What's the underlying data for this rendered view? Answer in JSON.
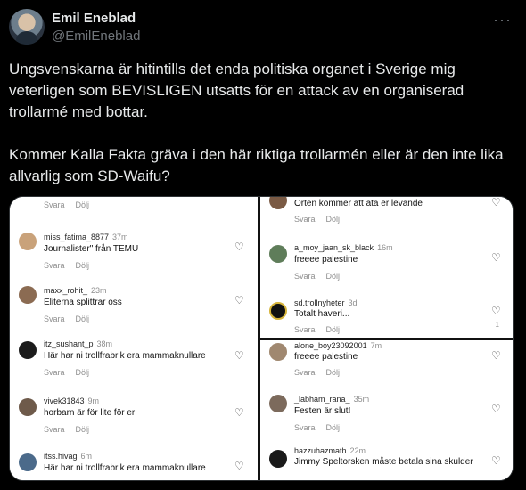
{
  "author": {
    "name": "Emil Eneblad",
    "handle": "@EmilEneblad"
  },
  "more_label": "···",
  "tweet": {
    "paragraph1": "Ungsvenskarna är hitintills det enda politiska organet i Sverige mig veterligen som BEVISLIGEN utsatts för en attack av en organiserad trollarmé med bottar.",
    "paragraph2": "Kommer Kalla Fakta gräva i den här riktiga trollarmén eller är den inte lika allvarlig som SD-Waifu?"
  },
  "actions": {
    "reply": "Svara",
    "hide": "Dölj"
  },
  "left_comments": [
    {
      "user": "",
      "time": "",
      "text": "",
      "avatar_color": "#9a7b66"
    },
    {
      "user": "miss_fatima_8877",
      "time": "37m",
      "text": "Journalister\" från TEMU",
      "avatar_color": "#c9a27a"
    },
    {
      "user": "maxx_rohit_",
      "time": "23m",
      "text": "Eliterna splittrar oss",
      "avatar_color": "#8b6b52"
    },
    {
      "user": "itz_sushant_p",
      "time": "38m",
      "text": "Här har ni trollfrabrik era mammaknullare",
      "avatar_color": "#1c1c1c"
    },
    {
      "user": "vivek31843",
      "time": "9m",
      "text": "horbarn är för lite för er",
      "avatar_color": "#6e5a4a"
    },
    {
      "user": "itss.hivag",
      "time": "6m",
      "text": "Här har ni trollfrabrik era mammaknullare",
      "avatar_color": "#4b6a8a"
    }
  ],
  "right_comments": [
    {
      "user": "",
      "time": "",
      "text": "Orten kommer att äta er levande",
      "avatar_color": "#7a5a44",
      "likes": ""
    },
    {
      "user": "a_moy_jaan_sk_black",
      "time": "16m",
      "text": "freeee palestine",
      "avatar_color": "#5f7d5a",
      "likes": ""
    },
    {
      "user": "sd.trollnyheter",
      "time": "3d",
      "text": "Totalt haveri...",
      "avatar_color": "#111111",
      "likes": "1"
    },
    {
      "user": "alone_boy23092001",
      "time": "7m",
      "text": "freeee palestine",
      "avatar_color": "#a08870",
      "likes": ""
    },
    {
      "user": "_labham_rana_",
      "time": "35m",
      "text": "Festen är slut!",
      "avatar_color": "#7c6a5c",
      "likes": ""
    },
    {
      "user": "hazzuhazmath",
      "time": "22m",
      "text": "Jimmy Speltorsken måste betala sina skulder",
      "avatar_color": "#1a1a1a",
      "likes": ""
    }
  ]
}
